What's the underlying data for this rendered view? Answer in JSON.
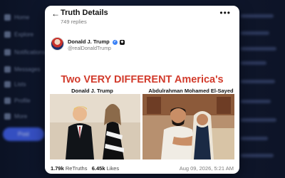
{
  "background": {
    "sidebar_items": [
      "Home",
      "Explore",
      "Notifications",
      "Messages",
      "Lists",
      "Profile",
      "More"
    ],
    "post_button": "Post"
  },
  "header": {
    "title": "Truth Details",
    "replies": "749 replies"
  },
  "post": {
    "author_name": "Donald J. Trump",
    "handle": "@realDonaldTrump",
    "headline": "Two VERY DIFFERENT America's",
    "left_label": "Donald J. Trump",
    "right_label": "Abdulrahman Mohamed El-Sayed",
    "retruths_count": "1.79k",
    "retruths_label": "ReTruths",
    "likes_count": "6.45k",
    "likes_label": "Likes",
    "timestamp": "Aug 09, 2026, 5:21 AM"
  },
  "colors": {
    "headline": "#d23b2c",
    "verified": "#3b82f6",
    "backdrop": "#0f172a"
  }
}
